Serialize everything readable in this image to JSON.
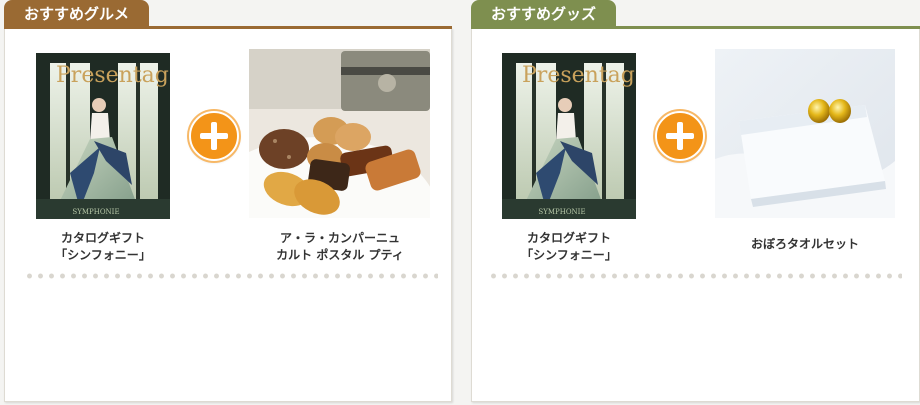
{
  "gourmet": {
    "tab_label": "おすすめグルメ",
    "accent": "#9a6a33",
    "items": [
      {
        "icon": "catalog-book-image",
        "line1": "カタログギフト",
        "line2": "「シンフォニー」",
        "logo": "Presentage"
      },
      {
        "icon": "sweets-assortment-image",
        "line1": "ア・ラ・カンパーニュ",
        "line2": "カルト ポスタル プティ"
      }
    ],
    "plus_icon": "plus-icon"
  },
  "goods": {
    "tab_label": "おすすめグッズ",
    "accent": "#7e8f4f",
    "items": [
      {
        "icon": "catalog-book-image",
        "line1": "カタログギフト",
        "line2": "「シンフォニー」",
        "logo": "Presentage"
      },
      {
        "icon": "towel-image",
        "line1": "おぼろタオルセット",
        "line2": ""
      }
    ],
    "plus_icon": "plus-icon"
  },
  "colors": {
    "plus": "#f39418",
    "dots": "#d9d6cf"
  }
}
